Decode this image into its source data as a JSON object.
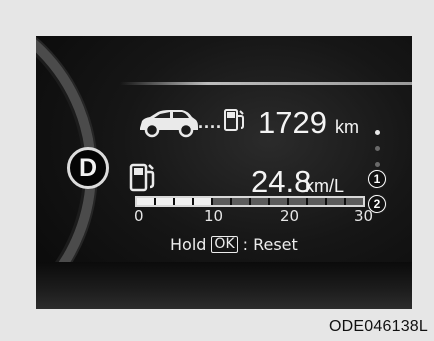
{
  "gear": "D",
  "range": {
    "value": "1729",
    "unit": "km"
  },
  "range_dots": "....",
  "fuel_economy": {
    "value": "24.8",
    "unit": "km/L"
  },
  "economy_bar": {
    "fill_segments": 4,
    "total_segments": 12
  },
  "scale_ticks": [
    "0",
    "10",
    "20",
    "30"
  ],
  "reset_hint": {
    "prefix": "Hold",
    "button": "OK",
    "suffix": ": Reset"
  },
  "callouts": [
    "1",
    "2"
  ],
  "page_indicator": {
    "count": 3,
    "active_index": 0
  },
  "image_code": "ODE046138L"
}
